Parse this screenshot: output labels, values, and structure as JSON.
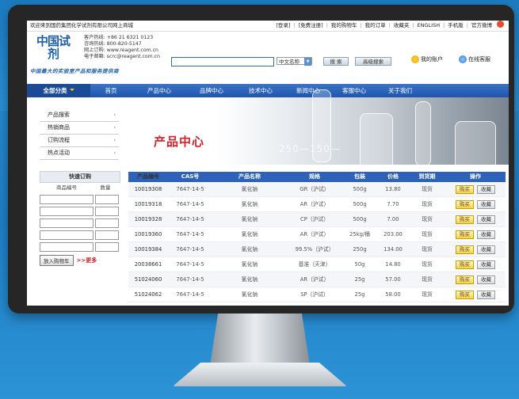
{
  "topbar": {
    "welcome": "欢迎来到国药集团化学试剂有限公司网上商城",
    "links": [
      "[登录]",
      "[免费注册]",
      "我的购物车",
      "我的订单",
      "收藏夹",
      "ENGLISH",
      "手机版",
      "官方微博"
    ]
  },
  "header": {
    "logo_zh": "中国试剂",
    "slogan": "中国最大的实验室产品和服务提供商",
    "contact": [
      "客户热线: +86 21 6321 0123",
      "咨询热线: 800-820-5147",
      "网上订购: www.reagent.com.cn",
      "电子邮箱: scrc@reagent.com.cn"
    ],
    "search_placeholder": "",
    "search_select": "中文名称",
    "search_button": "搜 索",
    "advanced_button": "高级搜索",
    "account": "我的账户",
    "service": "在线客服"
  },
  "nav": {
    "all_label": "全部分类",
    "items": [
      "首页",
      "产品中心",
      "品牌中心",
      "技术中心",
      "新闻中心",
      "客服中心",
      "关于我们"
    ]
  },
  "banner": {
    "title": "产品中心",
    "nums": "250—150—"
  },
  "leftmenu": [
    "产品搜索",
    "热销商品",
    "订购流程",
    "热点活动"
  ],
  "quick": {
    "title": "快速订购",
    "col_code": "商品编号",
    "col_qty": "数量",
    "cart_button": "放入购物车",
    "more": ">>更多"
  },
  "table": {
    "headers": [
      "产品编号",
      "CAS号",
      "产品名称",
      "规格",
      "包装",
      "价格",
      "到货期",
      "操作"
    ],
    "buy_label": "购买",
    "fav_label": "收藏",
    "rows": [
      {
        "code": "10019308",
        "cas": "7647-14-5",
        "name": "氯化钠",
        "spec": "GR（沪试）",
        "pack": "500g",
        "price": "13.80",
        "arrival": "现货"
      },
      {
        "code": "10019318",
        "cas": "7647-14-5",
        "name": "氯化钠",
        "spec": "AR（沪试）",
        "pack": "500g",
        "price": "7.70",
        "arrival": "现货"
      },
      {
        "code": "10019328",
        "cas": "7647-14-5",
        "name": "氯化钠",
        "spec": "CP（沪试）",
        "pack": "500g",
        "price": "7.00",
        "arrival": "现货"
      },
      {
        "code": "10019360",
        "cas": "7647-14-5",
        "name": "氯化钠",
        "spec": "AR（沪试）",
        "pack": "25kg/桶",
        "price": "203.00",
        "arrival": "现货"
      },
      {
        "code": "10019384",
        "cas": "7647-14-5",
        "name": "氯化钠",
        "spec": "99.5%（沪试）",
        "pack": "250g",
        "price": "134.00",
        "arrival": "现货"
      },
      {
        "code": "20038661",
        "cas": "7647-14-5",
        "name": "氯化钠",
        "spec": "基准（天津）",
        "pack": "50g",
        "price": "14.80",
        "arrival": "现货"
      },
      {
        "code": "51024060",
        "cas": "7647-14-5",
        "name": "氯化钠",
        "spec": "AR（沪试）",
        "pack": "25g",
        "price": "57.00",
        "arrival": "现货"
      },
      {
        "code": "51024062",
        "cas": "7647-14-5",
        "name": "氯化钠",
        "spec": "SP（沪试）",
        "pack": "25g",
        "price": "58.00",
        "arrival": "现货"
      }
    ]
  },
  "colors": {
    "nav": "#2d62b8",
    "accent_red": "#d4202a",
    "background": "#2a8fd2"
  }
}
